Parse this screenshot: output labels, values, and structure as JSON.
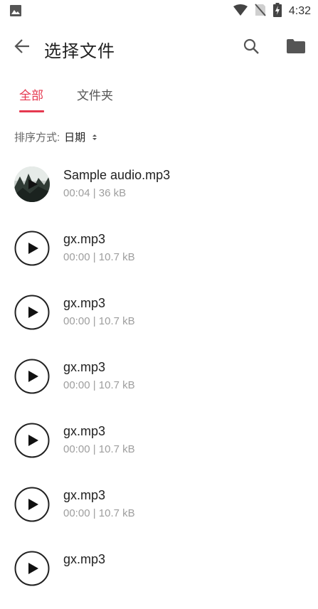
{
  "status_bar": {
    "time": "4:32",
    "icons": [
      "gallery-icon",
      "wifi-icon",
      "no-sim-icon",
      "battery-charging-icon"
    ]
  },
  "toolbar": {
    "title": "选择文件",
    "icons": [
      "back-arrow-icon",
      "search-icon",
      "folder-icon"
    ]
  },
  "tabs": [
    {
      "label": "全部",
      "active": true
    },
    {
      "label": "文件夹",
      "active": false
    }
  ],
  "sort": {
    "label": "排序方式:",
    "value": "日期"
  },
  "files": [
    {
      "name": "Sample audio.mp3",
      "meta": "00:04 | 36 kB",
      "has_thumbnail": true
    },
    {
      "name": "gx.mp3",
      "meta": "00:00 | 10.7 kB",
      "has_thumbnail": false
    },
    {
      "name": "gx.mp3",
      "meta": "00:00 | 10.7 kB",
      "has_thumbnail": false
    },
    {
      "name": "gx.mp3",
      "meta": "00:00 | 10.7 kB",
      "has_thumbnail": false
    },
    {
      "name": "gx.mp3",
      "meta": "00:00 | 10.7 kB",
      "has_thumbnail": false
    },
    {
      "name": "gx.mp3",
      "meta": "00:00 | 10.7 kB",
      "has_thumbnail": false
    },
    {
      "name": "gx.mp3",
      "meta": "",
      "has_thumbnail": false
    }
  ],
  "colors": {
    "accent": "#e5384f",
    "secondary_text": "#9e9e9e"
  }
}
